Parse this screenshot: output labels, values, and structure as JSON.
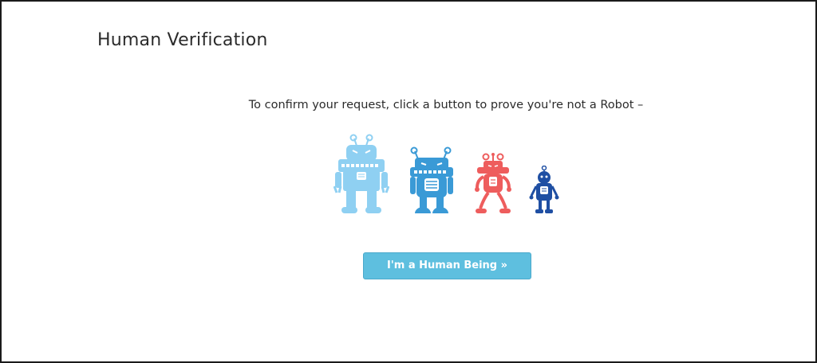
{
  "page": {
    "title": "Human Verification",
    "instruction": "To confirm your request, click a button to prove you're not a Robot –"
  },
  "illustration": {
    "robots": [
      {
        "icon": "robot-large-icon",
        "color": "#8fd0f2"
      },
      {
        "icon": "robot-medium-icon",
        "color": "#3a9ad6"
      },
      {
        "icon": "robot-small-icon",
        "color": "#ee5d5d"
      },
      {
        "icon": "robot-tiny-icon",
        "color": "#1f4fa3"
      }
    ]
  },
  "actions": {
    "human_button_label": "I'm a Human Being »",
    "button_color": "#5ebfdf"
  }
}
